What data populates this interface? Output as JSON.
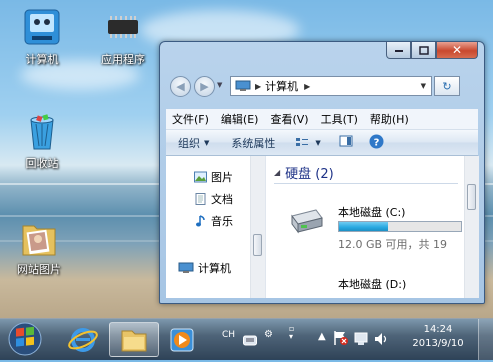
{
  "desktop": {
    "icons": [
      {
        "label": "计算机"
      },
      {
        "label": "应用程序"
      },
      {
        "label": "回收站"
      },
      {
        "label": "网站图片"
      }
    ]
  },
  "window": {
    "address_path": "计算机",
    "menu": [
      "文件(F)",
      "编辑(E)",
      "查看(V)",
      "工具(T)",
      "帮助(H)"
    ],
    "toolbar": {
      "organize": "组织",
      "system_properties": "系统属性"
    },
    "nav_items": [
      {
        "label": "图片",
        "icon": "picture-icon"
      },
      {
        "label": "文档",
        "icon": "document-icon"
      },
      {
        "label": "音乐",
        "icon": "music-icon"
      },
      {
        "label": "计算机",
        "icon": "computer-icon"
      }
    ],
    "group": {
      "title": "硬盘 (2)"
    },
    "drives": [
      {
        "name": "本地磁盘 (C:)",
        "free_text": "12.0 GB 可用，共 19",
        "used_fraction": 0.4
      },
      {
        "name": "本地磁盘 (D:)"
      }
    ]
  },
  "taskbar": {
    "lang": "CH",
    "time": "14:24",
    "date": "2013/9/10"
  },
  "colors": {
    "accent": "#1e395b",
    "group_title": "#1e3287",
    "drive_bar": "#27a8e0"
  }
}
